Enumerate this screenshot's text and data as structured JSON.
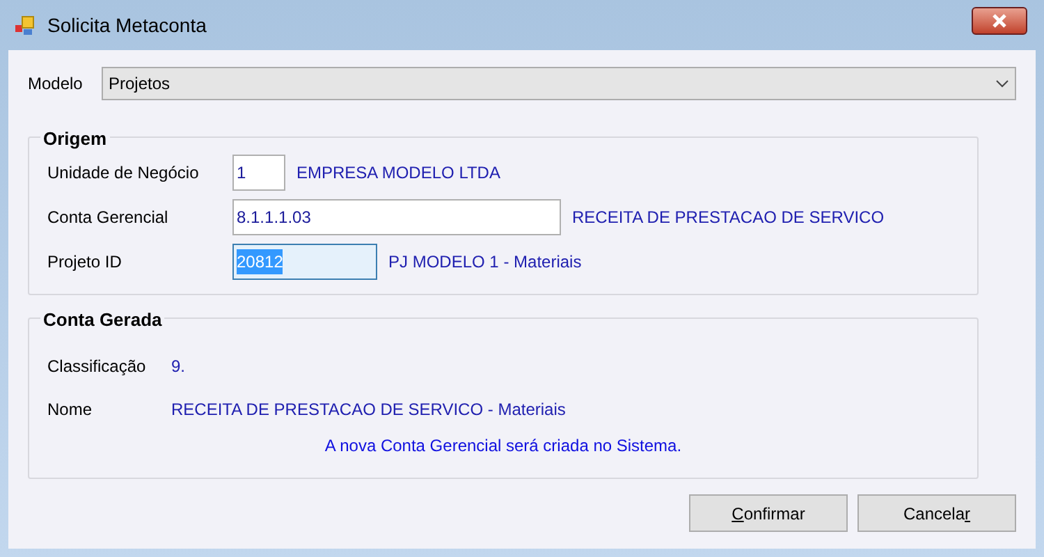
{
  "window": {
    "title": "Solicita Metaconta"
  },
  "modelo": {
    "label": "Modelo",
    "value": "Projetos"
  },
  "origem": {
    "title": "Origem",
    "fields": [
      {
        "label": "Unidade de Negócio",
        "value": "1",
        "description": "EMPRESA MODELO LTDA",
        "selected": false
      },
      {
        "label": "Conta Gerencial",
        "value": "8.1.1.1.03",
        "description": "RECEITA DE PRESTACAO DE SERVICO",
        "selected": false
      },
      {
        "label": "Projeto ID",
        "value": "20812",
        "description": "PJ MODELO 1 - Materiais",
        "selected": true
      }
    ]
  },
  "conta_gerada": {
    "title": "Conta Gerada",
    "rows": [
      {
        "label": "Classificação",
        "value": "9."
      },
      {
        "label": "Nome",
        "value": "RECEITA DE PRESTACAO DE SERVICO - Materiais"
      }
    ],
    "message": "A nova Conta Gerencial será criada no Sistema."
  },
  "buttons": [
    {
      "key": "C",
      "after": "onfirmar"
    },
    {
      "before": "Cancela",
      "key": "r"
    }
  ]
}
